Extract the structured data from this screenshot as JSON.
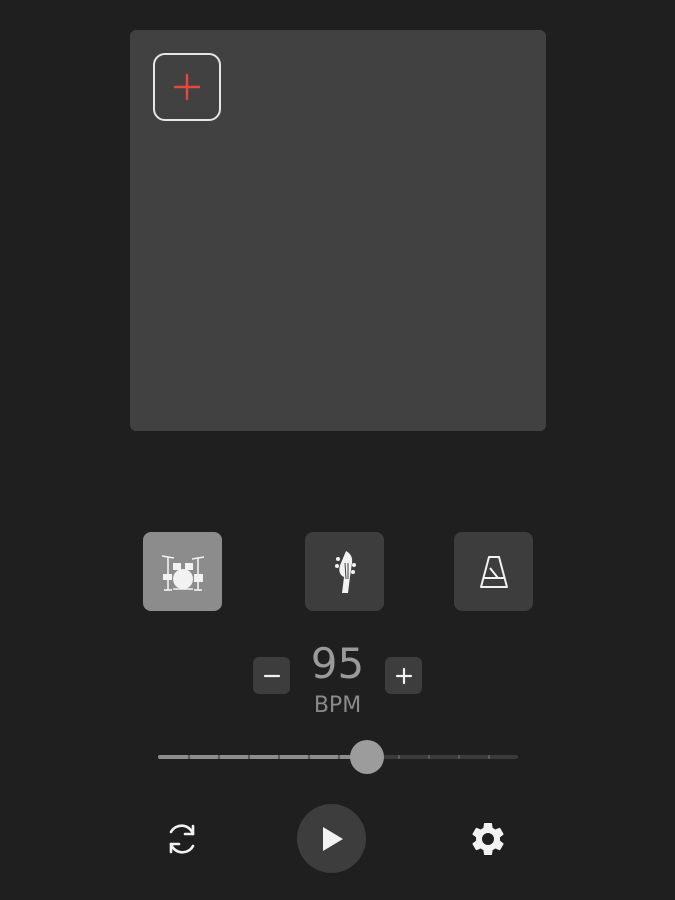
{
  "pad_area": {
    "add_icon": "plus-icon",
    "accent_color": "#e8483c"
  },
  "modes": [
    {
      "id": "drums",
      "icon": "drum-kit-icon",
      "active": true
    },
    {
      "id": "bass",
      "icon": "bass-guitar-headstock-icon",
      "active": false
    },
    {
      "id": "metronome",
      "icon": "metronome-icon",
      "active": false
    }
  ],
  "tempo": {
    "value": "95",
    "unit": "BPM",
    "minus_label": "−",
    "plus_label": "+",
    "slider_fraction": 0.58
  },
  "controls": {
    "loop_icon": "loop-icon",
    "play_icon": "play-icon",
    "settings_icon": "gear-icon"
  }
}
